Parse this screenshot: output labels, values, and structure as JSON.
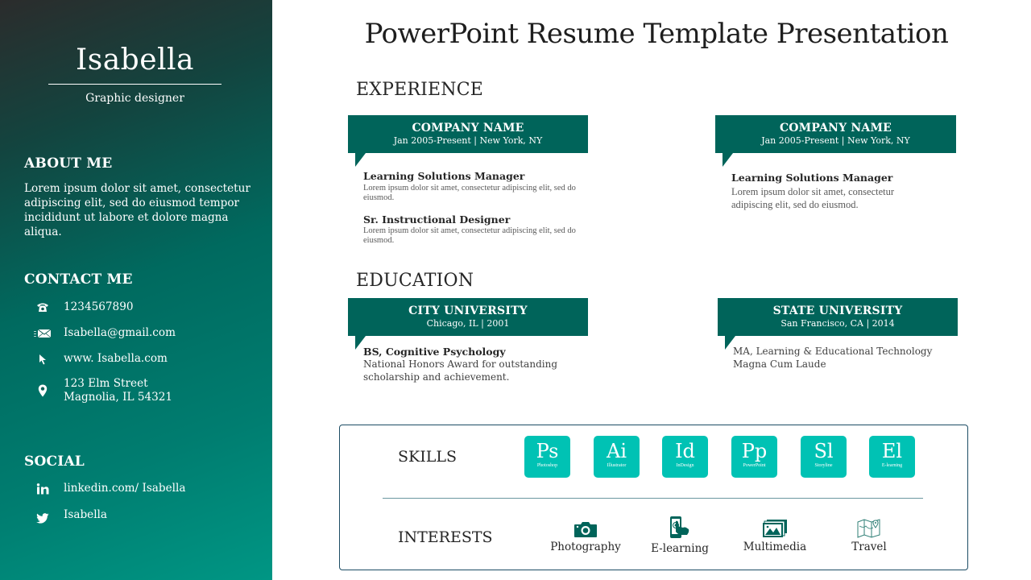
{
  "title": "PowerPoint Resume Template Presentation",
  "sidebar": {
    "name": "Isabella",
    "role": "Graphic designer",
    "about": {
      "heading": "ABOUT ME",
      "text": "Lorem ipsum dolor sit amet, consectetur adipiscing elit, sed do eiusmod tempor incididunt ut labore et dolore magna aliqua."
    },
    "contact": {
      "heading": "CONTACT ME",
      "items": [
        {
          "icon": "phone-icon",
          "line1": "1234567890"
        },
        {
          "icon": "email-icon",
          "line1": "Isabella@gmail.com"
        },
        {
          "icon": "cursor-icon",
          "line1": "www. Isabella.com"
        },
        {
          "icon": "location-pin-icon",
          "line1": "123 Elm Street",
          "line2": "Magnolia, IL 54321"
        }
      ]
    },
    "social": {
      "heading": "SOCIAL",
      "items": [
        {
          "icon": "linkedin-icon",
          "label": "linkedin.com/ Isabella"
        },
        {
          "icon": "twitter-icon",
          "label": "Isabella"
        }
      ]
    }
  },
  "experience": {
    "heading": "EXPERIENCE",
    "cards": [
      {
        "company": "COMPANY  NAME",
        "meta": "Jan 2005-Present  |  New York, NY",
        "roles": [
          {
            "title": "Learning Solutions Manager",
            "text": "Lorem ipsum dolor sit amet, consectetur adipiscing elit, sed do eiusmod."
          },
          {
            "title": "Sr. Instructional Designer",
            "text": "Lorem ipsum dolor sit amet, consectetur adipiscing elit, sed do eiusmod."
          }
        ]
      },
      {
        "company": "COMPANY  NAME",
        "meta": "Jan 2005-Present  |  New York, NY",
        "roles": [
          {
            "title": "Learning Solutions Manager",
            "text": "Lorem ipsum dolor sit amet, consectetur adipiscing  elit, sed do eiusmod."
          }
        ]
      }
    ]
  },
  "education": {
    "heading": "EDUCATION",
    "cards": [
      {
        "school": "CITY UNIVERSITY",
        "meta": "Chicago, IL  |  2001",
        "degree": "BS, Cognitive Psychology",
        "text": "National Honors Award for outstanding scholarship and achievement."
      },
      {
        "school": "STATE UNIVERSITY",
        "meta": "San Francisco, CA  |  2014",
        "degree": "",
        "text_line1": "MA, Learning & Educational Technology",
        "text_line2": "Magna Cum Laude"
      }
    ]
  },
  "skills": {
    "heading": "SKILLS",
    "items": [
      {
        "abbr": "Ps",
        "label": "Photoshop"
      },
      {
        "abbr": "Ai",
        "label": "Illustrator"
      },
      {
        "abbr": "Id",
        "label": "InDesign"
      },
      {
        "abbr": "Pp",
        "label": "PowerPoint"
      },
      {
        "abbr": "Sl",
        "label": "Storyline"
      },
      {
        "abbr": "El",
        "label": "E-learning"
      }
    ]
  },
  "interests": {
    "heading": "INTERESTS",
    "items": [
      {
        "icon": "camera-icon",
        "label": "Photography"
      },
      {
        "icon": "mobile-touch-icon",
        "label": "E-learning"
      },
      {
        "icon": "image-stack-icon",
        "label": "Multimedia"
      },
      {
        "icon": "map-icon",
        "label": "Travel"
      }
    ]
  },
  "colors": {
    "header_teal": "#00645a",
    "skill_tile": "#00c2b4",
    "sidebar_dark": "#2b2c2c",
    "sidebar_teal": "#009684",
    "box_border": "#1c4c64"
  }
}
